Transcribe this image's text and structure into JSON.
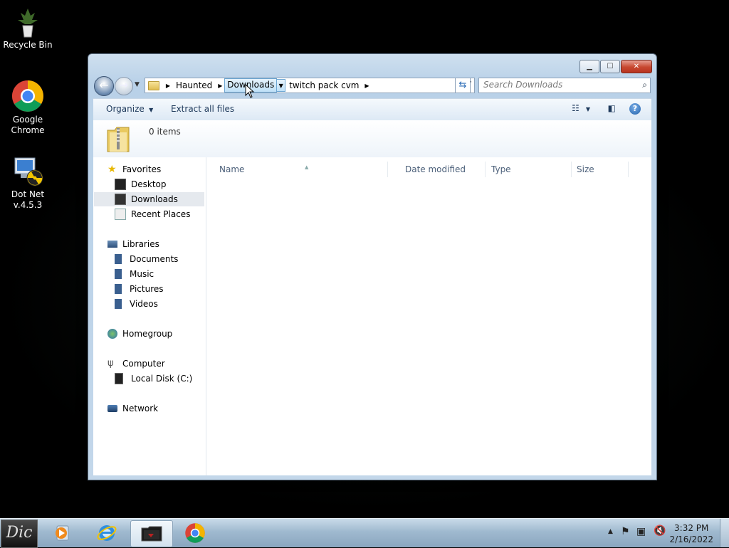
{
  "desktop": {
    "icons": [
      {
        "label": "Recycle Bin"
      },
      {
        "label": "Google Chrome"
      },
      {
        "label": "Dot Net v.4.5.3"
      }
    ]
  },
  "window": {
    "breadcrumb": [
      "Haunted",
      "Downloads",
      "twitch pack cvm"
    ],
    "search_placeholder": "Search Downloads",
    "toolbar": {
      "organize": "Organize",
      "extract": "Extract all files"
    },
    "details": {
      "item_count": "0 items"
    },
    "nav": {
      "favorites": "Favorites",
      "desktop": "Desktop",
      "downloads": "Downloads",
      "recent": "Recent Places",
      "libraries": "Libraries",
      "documents": "Documents",
      "music": "Music",
      "pictures": "Pictures",
      "videos": "Videos",
      "homegroup": "Homegroup",
      "computer": "Computer",
      "local_disk": "Local Disk (C:)",
      "network": "Network"
    },
    "columns": [
      "Name",
      "Date modified",
      "Type",
      "Size"
    ]
  },
  "taskbar": {
    "start_label": "Dic",
    "time": "3:32 PM",
    "date": "2/16/2022"
  },
  "colors": {
    "accent": "#3d5574",
    "selection": "#e5e9ee",
    "hover_crumb": "#bfe0f7"
  }
}
